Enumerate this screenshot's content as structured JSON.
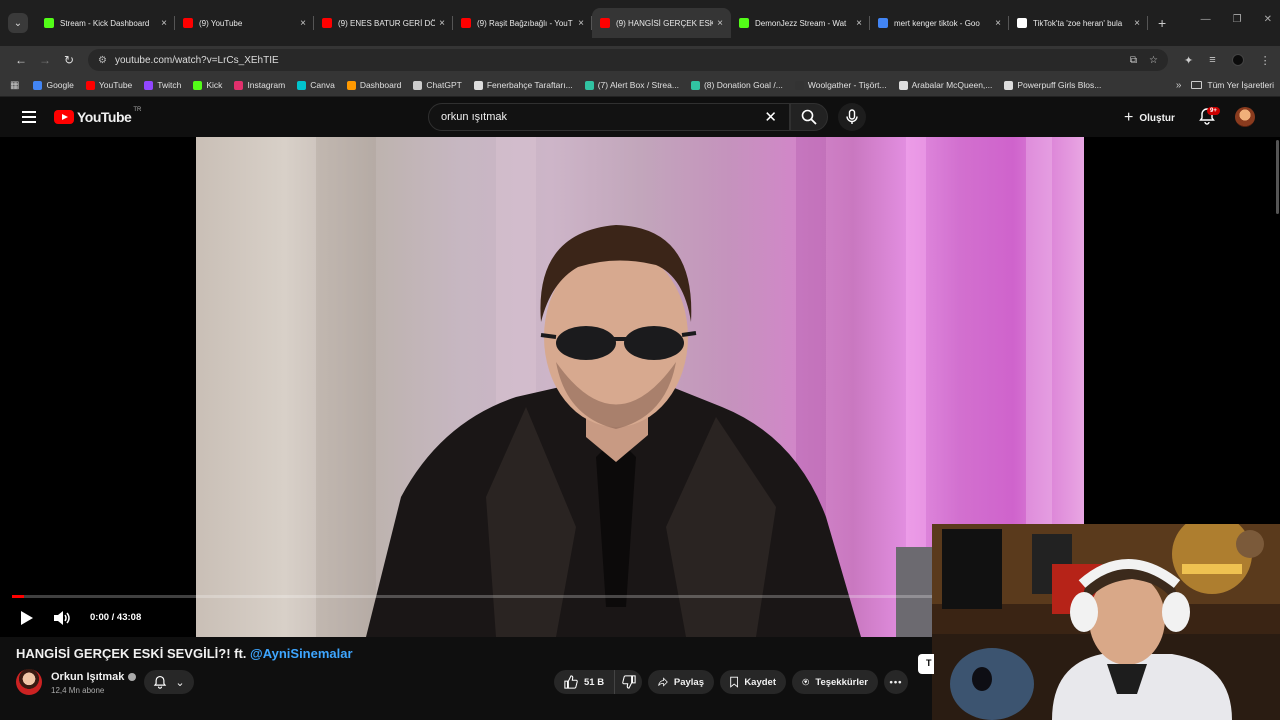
{
  "browser": {
    "tabs": [
      {
        "title": "Stream - Kick Dashboard",
        "favicon": "kick-icon",
        "color": "#53fc18",
        "active": false
      },
      {
        "title": "(9) YouTube",
        "favicon": "youtube-icon",
        "color": "#ff0000",
        "active": false
      },
      {
        "title": "(9) ENES BATUR GERİ DÖN",
        "favicon": "youtube-icon",
        "color": "#ff0000",
        "active": false
      },
      {
        "title": "(9) Raşit Bağzıbağlı - YouT",
        "favicon": "youtube-icon",
        "color": "#ff0000",
        "active": false
      },
      {
        "title": "(9) HANGİSİ GERÇEK ESKİ",
        "favicon": "youtube-icon",
        "color": "#ff0000",
        "active": true
      },
      {
        "title": "DemonJezz Stream - Wat",
        "favicon": "kick-icon",
        "color": "#53fc18",
        "active": false
      },
      {
        "title": "mert kenger tiktok - Goo",
        "favicon": "google-icon",
        "color": "#4285f4",
        "active": false
      },
      {
        "title": "TikTok'ta 'zoe heran' bula",
        "favicon": "tiktok-icon",
        "color": "#ffffff",
        "active": false
      }
    ],
    "tab_close": "×",
    "new_tab": "+",
    "url": "youtube.com/watch?v=LrCs_XEhTIE",
    "bookmarks": [
      {
        "label": "Google",
        "color": "#4285f4"
      },
      {
        "label": "YouTube",
        "color": "#ff0000"
      },
      {
        "label": "Twitch",
        "color": "#9146ff"
      },
      {
        "label": "Kick",
        "color": "#53fc18"
      },
      {
        "label": "Instagram",
        "color": "#e1306c"
      },
      {
        "label": "Canva",
        "color": "#00c4cc"
      },
      {
        "label": "Dashboard",
        "color": "#ff9900"
      },
      {
        "label": "ChatGPT",
        "color": "#cccccc"
      },
      {
        "label": "Fenerbahçe Taraftarı...",
        "color": "#dddddd"
      },
      {
        "label": "(7) Alert Box / Strea...",
        "color": "#31c3a2"
      },
      {
        "label": "(8) Donation Goal /...",
        "color": "#31c3a2"
      },
      {
        "label": "Woolgather - Tişört...",
        "color": "#333333"
      },
      {
        "label": "Arabalar McQueen,...",
        "color": "#dddddd"
      },
      {
        "label": "Powerpuff Girls Blos...",
        "color": "#dddddd"
      }
    ],
    "bookmarks_more": "»",
    "all_bookmarks": "Tüm Yer İşaretleri"
  },
  "youtube": {
    "logo_text": "YouTube",
    "region": "TR",
    "search_query": "orkun ışıtmak",
    "create_label": "Oluştur",
    "notif_badge": "9+"
  },
  "video": {
    "time": "0:00 / 43:08",
    "progress_fraction": 0.0,
    "title_main": "HANGİSİ GERÇEK ESKİ SEVGİLİ?! ft. ",
    "title_mention": "@AyniSinemalar"
  },
  "channel": {
    "name": "Orkun Işıtmak",
    "subscribers": "12,4 Mn abone"
  },
  "actions": {
    "likes": "51 B",
    "share": "Paylaş",
    "save": "Kaydet",
    "thanks": "Teşekkürler",
    "more": "•••",
    "side_chip": "T"
  }
}
